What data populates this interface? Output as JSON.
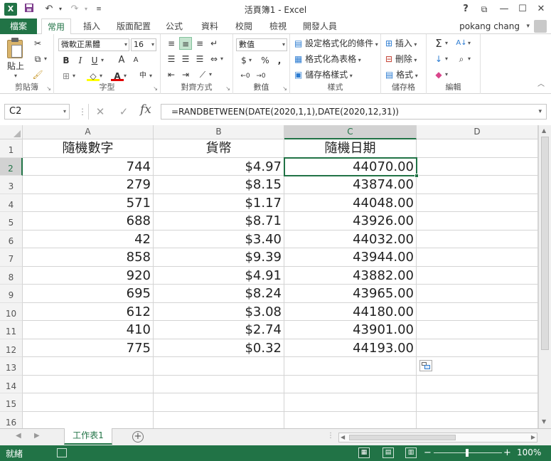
{
  "window": {
    "title": "活頁簿1 - Excel",
    "app_icon": "X",
    "undo_icon": "↶",
    "redo_icon": "↷",
    "help": "?",
    "restore_ribbon": "⧉",
    "minimize": "—",
    "maximize": "☐",
    "close": "✕"
  },
  "tabs": {
    "file": "檔案",
    "items": [
      "常用",
      "插入",
      "版面配置",
      "公式",
      "資料",
      "校閱",
      "檢視",
      "開發人員"
    ],
    "active_index": 0,
    "user": "pokang chang"
  },
  "ribbon": {
    "clipboard": {
      "paste": "貼上",
      "label": "剪貼簿"
    },
    "font": {
      "name": "微軟正黑體",
      "size": "16",
      "bold": "B",
      "italic": "I",
      "underline": "U",
      "grow": "A",
      "shrink": "A",
      "label": "字型"
    },
    "alignment": {
      "label": "對齊方式"
    },
    "number": {
      "format": "數值",
      "currency": "$",
      "percent": "%",
      "comma": ",",
      "label": "數值"
    },
    "styles": {
      "conditional": "設定格式化的條件",
      "table": "格式化為表格",
      "cell_styles": "儲存格樣式",
      "label": "樣式"
    },
    "cells": {
      "insert": "插入",
      "delete": "刪除",
      "format": "格式",
      "label": "儲存格"
    },
    "editing": {
      "label": "編輯"
    },
    "accent_color": "#217346"
  },
  "formula_bar": {
    "name_box": "C2",
    "cancel_icon": "✕",
    "enter_icon": "✓",
    "fx": "fx",
    "formula": "=RANDBETWEEN(DATE(2020,1,1),DATE(2020,12,31))"
  },
  "sheet": {
    "columns": [
      "A",
      "B",
      "C",
      "D"
    ],
    "selected_column": "C",
    "selected_row": 2,
    "rows": [
      1,
      2,
      3,
      4,
      5,
      6,
      7,
      8,
      9,
      10,
      11,
      12,
      13,
      14,
      15,
      16
    ],
    "headers": [
      "隨機數字",
      "貨幣",
      "隨機日期"
    ],
    "data": [
      [
        "744",
        "$4.97",
        "44070.00"
      ],
      [
        "279",
        "$8.15",
        "43874.00"
      ],
      [
        "571",
        "$1.17",
        "44048.00"
      ],
      [
        "688",
        "$8.71",
        "43926.00"
      ],
      [
        "42",
        "$3.40",
        "44032.00"
      ],
      [
        "858",
        "$9.39",
        "43944.00"
      ],
      [
        "920",
        "$4.91",
        "43882.00"
      ],
      [
        "695",
        "$8.24",
        "43965.00"
      ],
      [
        "612",
        "$3.08",
        "44180.00"
      ],
      [
        "410",
        "$2.74",
        "43901.00"
      ],
      [
        "775",
        "$0.32",
        "44193.00"
      ]
    ]
  },
  "sheet_tabs": {
    "active": "工作表1",
    "add": "+"
  },
  "status_bar": {
    "ready": "就緒",
    "zoom_out": "−",
    "zoom_in": "+",
    "zoom": "100%"
  }
}
